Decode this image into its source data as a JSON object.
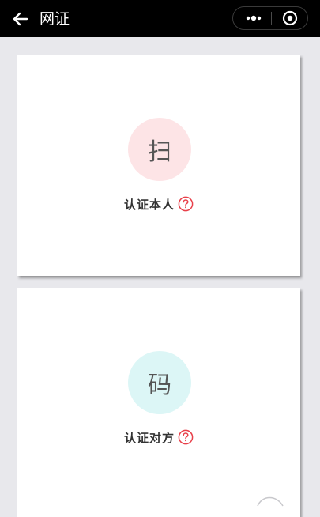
{
  "nav": {
    "title": "网证",
    "colors": {
      "bar": "#000000",
      "text": "#ffffff"
    }
  },
  "capsule": {
    "more_icon": "more-dots-icon",
    "close_icon": "target-close-icon"
  },
  "cards": [
    {
      "glyph": "扫",
      "label": "认证本人",
      "help_icon": "question-circle-icon",
      "circle_color": "#fde4e6"
    },
    {
      "glyph": "码",
      "label": "认证对方",
      "help_icon": "question-circle-icon",
      "circle_color": "#dcf6f6"
    }
  ],
  "colors": {
    "page_background": "#e8e8ec",
    "help_icon": "#e8404a"
  }
}
